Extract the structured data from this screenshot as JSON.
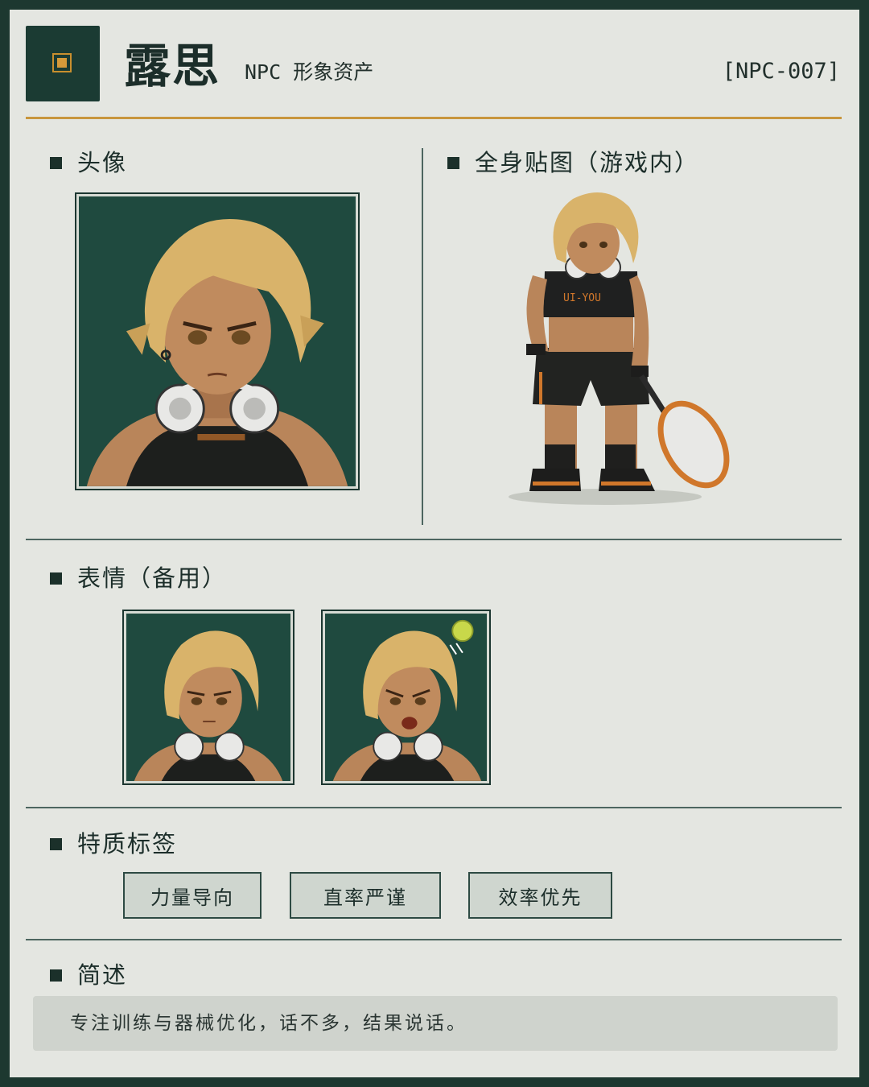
{
  "header": {
    "title": "露思",
    "subtitle": "NPC 形象资产",
    "code": "[NPC-007]"
  },
  "sections": {
    "portrait": "头像",
    "full_body": "全身贴图（游戏内）",
    "expressions": "表情（备用）",
    "traits": "特质标签",
    "summary": "简述"
  },
  "sprite": {
    "shirt_text": "UI-YOU"
  },
  "traits": [
    "力量导向",
    "直率严谨",
    "效率优先"
  ],
  "summary_text": "专注训练与器械优化，话不多，结果说话。",
  "colors": {
    "frame_border": "#1d3830",
    "panel_bg": "#e4e6e1",
    "accent_gold": "#c8963d",
    "portrait_bg": "#1f4a3f",
    "hair": "#d9b36a",
    "skin": "#b9855a"
  }
}
